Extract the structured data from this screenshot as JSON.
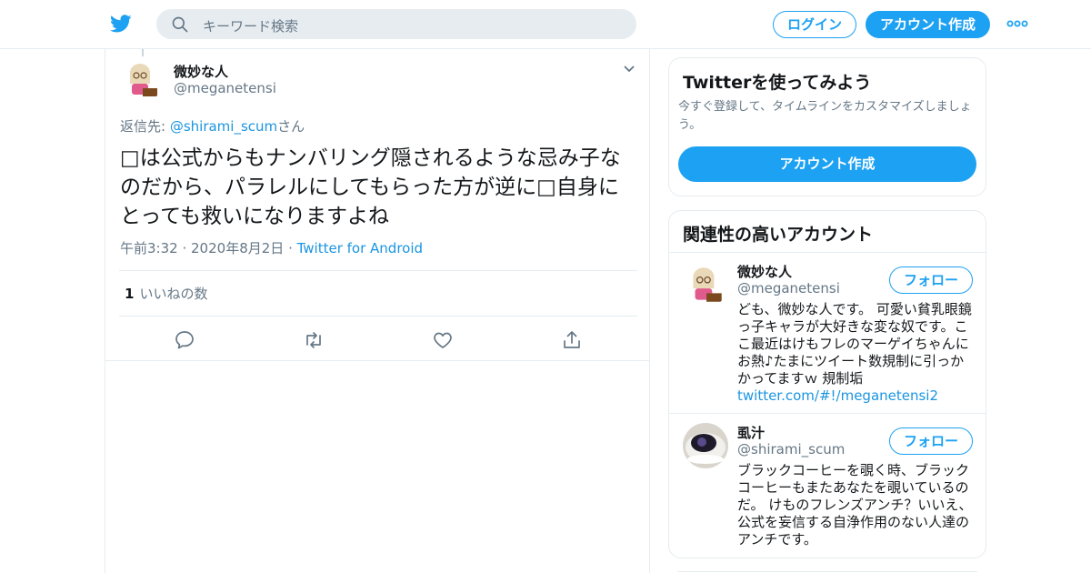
{
  "header": {
    "search_placeholder": "キーワード検索",
    "login_label": "ログイン",
    "signup_label": "アカウント作成"
  },
  "tweet": {
    "author_name": "微妙な人",
    "author_handle": "@meganetensi",
    "reply_prefix": "返信先: ",
    "reply_to": "@shirami_scum",
    "reply_suffix": "さん",
    "text": "□は公式からもナンバリング隠されるような忌み子なのだから、パラレルにしてもらった方が逆に□自身にとっても救いになりますよね",
    "time": "午前3:32",
    "date": "2020年8月2日",
    "source": "Twitter for Android",
    "like_count": "1",
    "like_label": "いいねの数"
  },
  "signup_card": {
    "title": "Twitterを使ってみよう",
    "description": "今すぐ登録して、タイムラインをカスタマイズしましょう。",
    "button_label": "アカウント作成"
  },
  "related": {
    "title": "関連性の高いアカウント",
    "accounts": [
      {
        "name": "微妙な人",
        "handle": "@meganetensi",
        "follow_label": "フォロー",
        "bio": "ども、微妙な人です。 可愛い貧乳眼鏡っ子キャラが大好きな変な奴です。ここ最近はけもフレのマーゲイちゃんにお熱♪たまにツイート数規制に引っかかってますｗ 規制垢",
        "bio_link": "twitter.com/#!/meganetensi2"
      },
      {
        "name": "虱汁",
        "handle": "@shirami_scum",
        "follow_label": "フォロー",
        "bio": "ブラックコーヒーを覗く時、ブラックコーヒーもまたあなたを覗いているのだ。 けものフレンズアンチ？いいえ、公式を妄信する自浄作用のない人達のアンチです。"
      }
    ]
  },
  "colors": {
    "brand": "#1da1f2",
    "link": "#1b95e0",
    "secondary_text": "#657786",
    "border": "#e6ecf0"
  },
  "icons": [
    "twitter-bird-icon",
    "search-icon",
    "more-dots-icon",
    "chevron-down-icon",
    "reply-icon",
    "retweet-icon",
    "like-icon",
    "share-icon"
  ]
}
